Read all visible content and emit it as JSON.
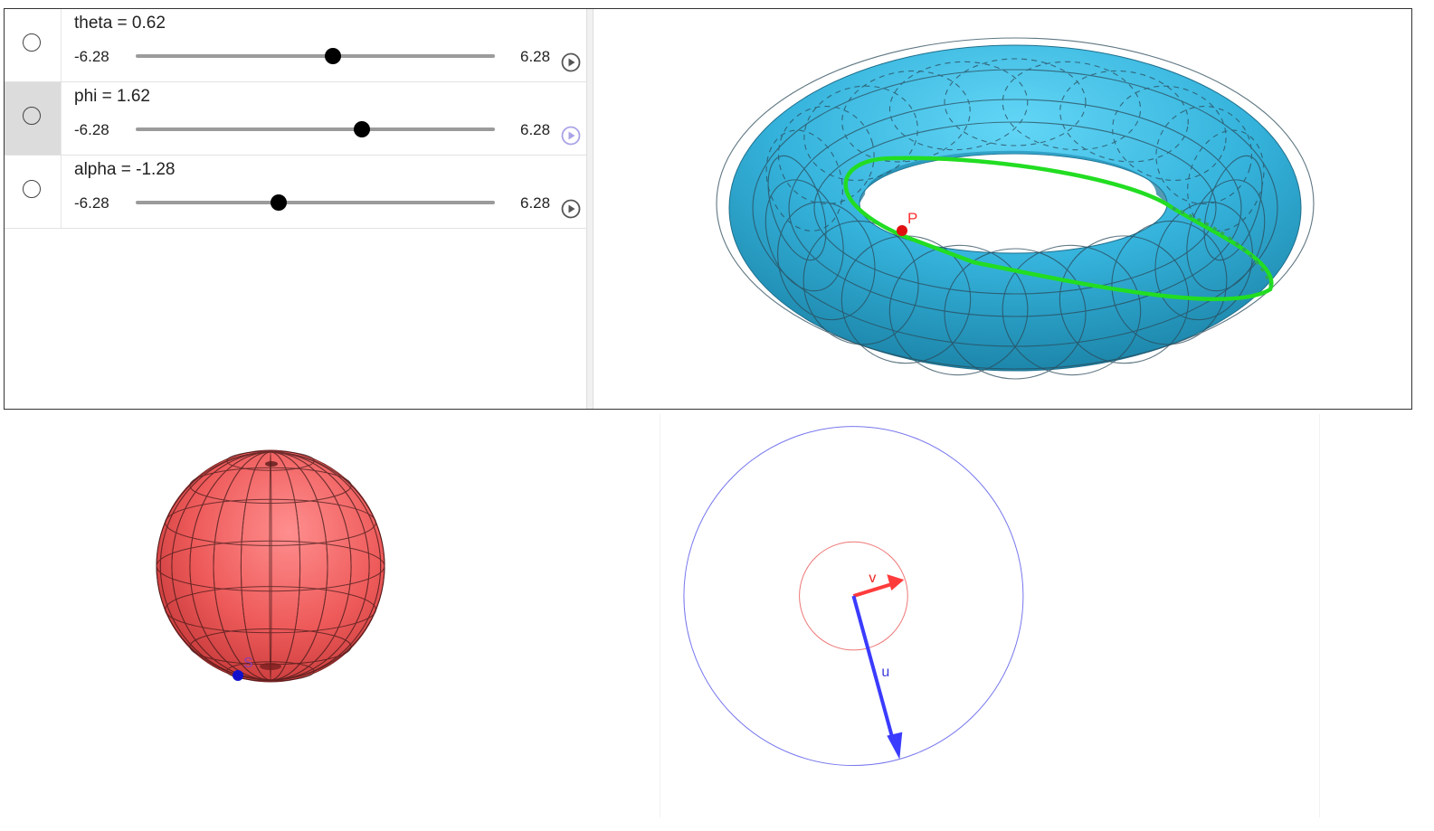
{
  "algebra": {
    "sliders": [
      {
        "name": "theta",
        "value": "0.62",
        "min": "-6.28",
        "max": "6.28",
        "fraction": 0.549,
        "selected": false,
        "play_active": false
      },
      {
        "name": "phi",
        "value": "1.62",
        "min": "-6.28",
        "max": "6.28",
        "fraction": 0.629,
        "selected": true,
        "play_active": true
      },
      {
        "name": "alpha",
        "value": "-1.28",
        "min": "-6.28",
        "max": "6.28",
        "fraction": 0.398,
        "selected": false,
        "play_active": false
      }
    ]
  },
  "torus": {
    "point_label": "P",
    "surface_color": "#35b3dc",
    "curve_color": "#22dd22",
    "point_color": "#e01010"
  },
  "sphere": {
    "point_label": "S",
    "surface_color": "#ee5a5a",
    "point_color": "#1010cc",
    "label_color": "#8a3fb0"
  },
  "vectors": {
    "v_label": "v",
    "u_label": "u",
    "v_color": "#ff3b3b",
    "u_color": "#3b3bff",
    "outer_circle_color": "#7777ee",
    "inner_circle_color": "#ee7777"
  }
}
